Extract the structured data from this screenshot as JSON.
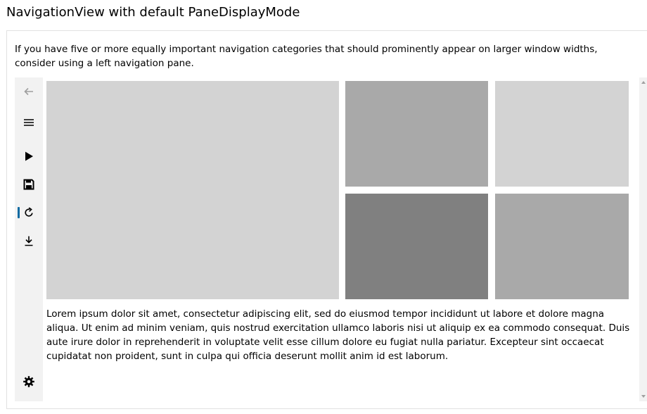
{
  "page": {
    "title": "NavigationView with default PaneDisplayMode"
  },
  "example": {
    "description": "If you have five or more equally important navigation categories that should prominently appear on larger window widths, consider using a left navigation pane."
  },
  "navigation_view": {
    "pane_items": [
      {
        "icon": "back-arrow-icon",
        "state": "disabled"
      },
      {
        "icon": "hamburger-menu-icon"
      },
      {
        "icon": "play-icon"
      },
      {
        "icon": "save-icon"
      },
      {
        "icon": "refresh-icon",
        "selected": true
      },
      {
        "icon": "download-icon"
      }
    ],
    "footer_item": {
      "icon": "gear-icon"
    },
    "accent_color": "#0b6aa2",
    "content": {
      "tiles": [
        {
          "color": "#d3d3d3"
        },
        {
          "color": "#a9a9a9"
        },
        {
          "color": "#d3d3d3"
        },
        {
          "color": "#808080"
        },
        {
          "color": "#a9a9a9"
        }
      ],
      "body_text": "Lorem ipsum dolor sit amet, consectetur adipiscing elit, sed do eiusmod tempor incididunt ut labore et dolore magna aliqua. Ut enim ad minim veniam, quis nostrud exercitation ullamco laboris nisi ut aliquip ex ea commodo consequat. Duis aute irure dolor in reprehenderit in voluptate velit esse cillum dolore eu fugiat nulla pariatur. Excepteur sint occaecat cupidatat non proident, sunt in culpa qui officia deserunt mollit anim id est laborum."
    }
  }
}
